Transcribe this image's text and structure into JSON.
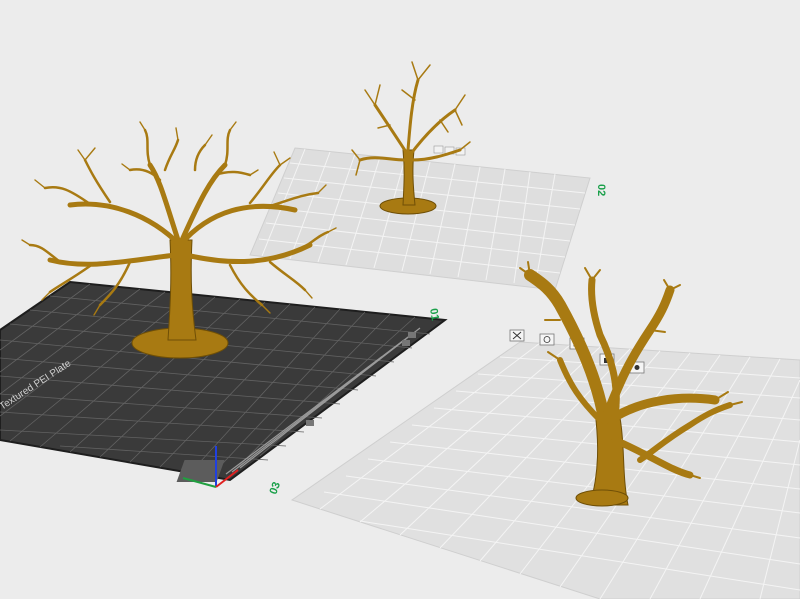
{
  "app": {
    "view": "3d-prepare-view"
  },
  "colors": {
    "background": "#ececec",
    "plate_light": "#dedede",
    "plate_light_grid": "#f4f4f4",
    "plate_dark": "#3a3a3a",
    "plate_dark_grid": "#6a6a6a",
    "model_fill": "#a87a12",
    "model_shadow": "#6f4f06",
    "plate_label": "#1aa04a",
    "axis_x": "#e02020",
    "axis_y": "#20a040",
    "axis_z": "#2040e0"
  },
  "plates": [
    {
      "id": "plate-1",
      "label": "01",
      "type": "textured",
      "name": "Textured PEI Plate",
      "model": "large bare tree"
    },
    {
      "id": "plate-2",
      "label": "02",
      "type": "smooth",
      "model": "small bare tree"
    },
    {
      "id": "plate-3",
      "label": "03",
      "type": "smooth",
      "model": "bare trunk tree"
    }
  ],
  "plate_icons": [
    "close-icon",
    "orient-icon",
    "arrange-icon",
    "lock-icon",
    "settings-icon"
  ]
}
